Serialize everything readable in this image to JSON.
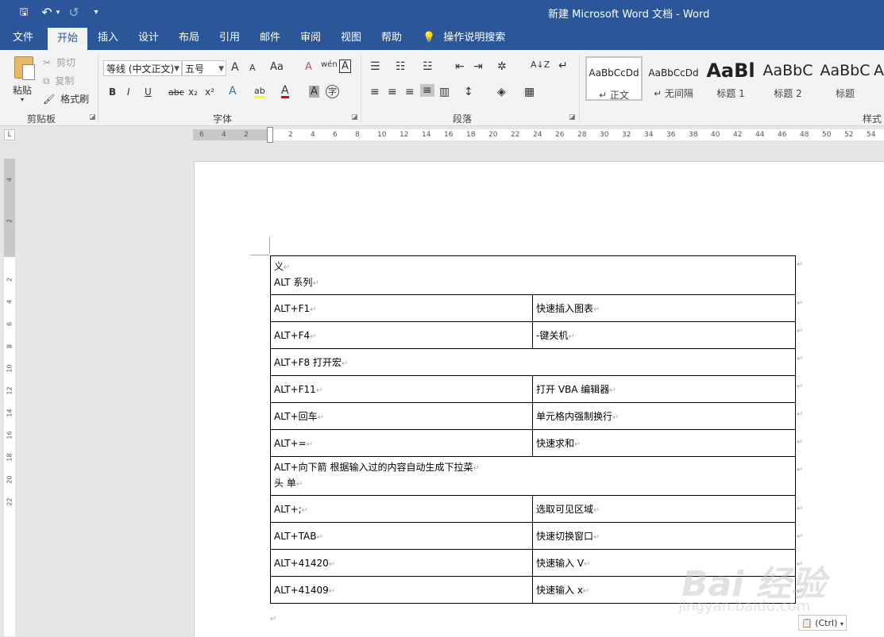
{
  "window": {
    "title": "新建 Microsoft Word 文档 - Word",
    "qat": {
      "save": "🖫",
      "undo": "↶",
      "undo_arrow": "▾",
      "redo": "↺",
      "customize": "▾"
    }
  },
  "tabs": [
    {
      "label": "文件"
    },
    {
      "label": "开始"
    },
    {
      "label": "插入"
    },
    {
      "label": "设计"
    },
    {
      "label": "布局"
    },
    {
      "label": "引用"
    },
    {
      "label": "邮件"
    },
    {
      "label": "审阅"
    },
    {
      "label": "视图"
    },
    {
      "label": "帮助"
    }
  ],
  "tell_me": {
    "icon": "💡",
    "label": "操作说明搜索"
  },
  "ribbon": {
    "clipboard": {
      "label": "剪贴板",
      "paste": "粘贴",
      "cut": "剪切",
      "copy": "复制",
      "format_painter": "格式刷"
    },
    "font": {
      "label": "字体",
      "font_name": "等线 (中文正文)",
      "font_size": "五号",
      "grow": "A",
      "shrink": "A",
      "change_case": "Aa",
      "clear_format": "A",
      "phonetic": "wén",
      "char_border": "A",
      "bold": "B",
      "italic": "I",
      "underline": "U",
      "strike": "abc",
      "subscript": "x₂",
      "superscript": "x²",
      "text_effect": "A",
      "highlight": "ab",
      "font_color": "A",
      "char_shading": "A",
      "enclose": "字"
    },
    "paragraph": {
      "label": "段落",
      "sort": "A↓Z",
      "para_mark": "↵"
    },
    "styles": {
      "label": "样式",
      "items": [
        {
          "preview": "AaBbCcDd",
          "name": "↵ 正文"
        },
        {
          "preview": "AaBbCcDd",
          "name": "↵ 无间隔"
        },
        {
          "preview": "AaBl",
          "name": "标题 1"
        },
        {
          "preview": "AaBbC",
          "name": "标题 2"
        },
        {
          "preview": "AaBbC",
          "name": "标题"
        },
        {
          "preview": "A",
          "name": ""
        }
      ]
    }
  },
  "ruler": {
    "corner": "L",
    "h_left": [
      "6",
      "4",
      "2"
    ],
    "h_right": [
      "2",
      "4",
      "6",
      "8",
      "10",
      "12",
      "14",
      "16",
      "18",
      "20",
      "22",
      "24",
      "26",
      "28",
      "30",
      "32",
      "34",
      "36",
      "38",
      "40",
      "42",
      "44",
      "46",
      "48",
      "50",
      "52",
      "54"
    ],
    "v_top": [
      "4",
      "2"
    ],
    "v_body": [
      "2",
      "4",
      "6",
      "8",
      "10",
      "12",
      "14",
      "16",
      "18",
      "20",
      "22"
    ]
  },
  "document": {
    "mark": "↵",
    "rows": [
      {
        "merged": true,
        "lines": [
          "义",
          "ALT 系列"
        ]
      },
      {
        "key": "ALT+F1",
        "desc": "快速插入图表"
      },
      {
        "key": "ALT+F4",
        "desc": "-键关机"
      },
      {
        "merged": true,
        "lines": [
          "ALT+F8  打开宏"
        ]
      },
      {
        "key": "ALT+F11",
        "desc": "打开 VBA 编辑器"
      },
      {
        "key": "ALT+回车",
        "desc": "单元格内强制换行"
      },
      {
        "key": "ALT+=",
        "desc": "快速求和"
      },
      {
        "merged": true,
        "lines": [
          "ALT+向下箭  根据输入过的内容自动生成下拉菜",
          "头  单"
        ]
      },
      {
        "key": "ALT+;",
        "desc": "选取可见区域"
      },
      {
        "key": "ALT+TAB",
        "desc": "快速切换窗口"
      },
      {
        "key": "ALT+41420",
        "desc": "快速输入 V"
      },
      {
        "key": "ALT+41409",
        "desc": "快速输入 x"
      }
    ]
  },
  "paste_options": {
    "icon": "📋",
    "label": "(Ctrl)",
    "arrow": "▾"
  },
  "watermark": {
    "brand": "Bai 经验",
    "url": "jingyan.baidu.com"
  }
}
